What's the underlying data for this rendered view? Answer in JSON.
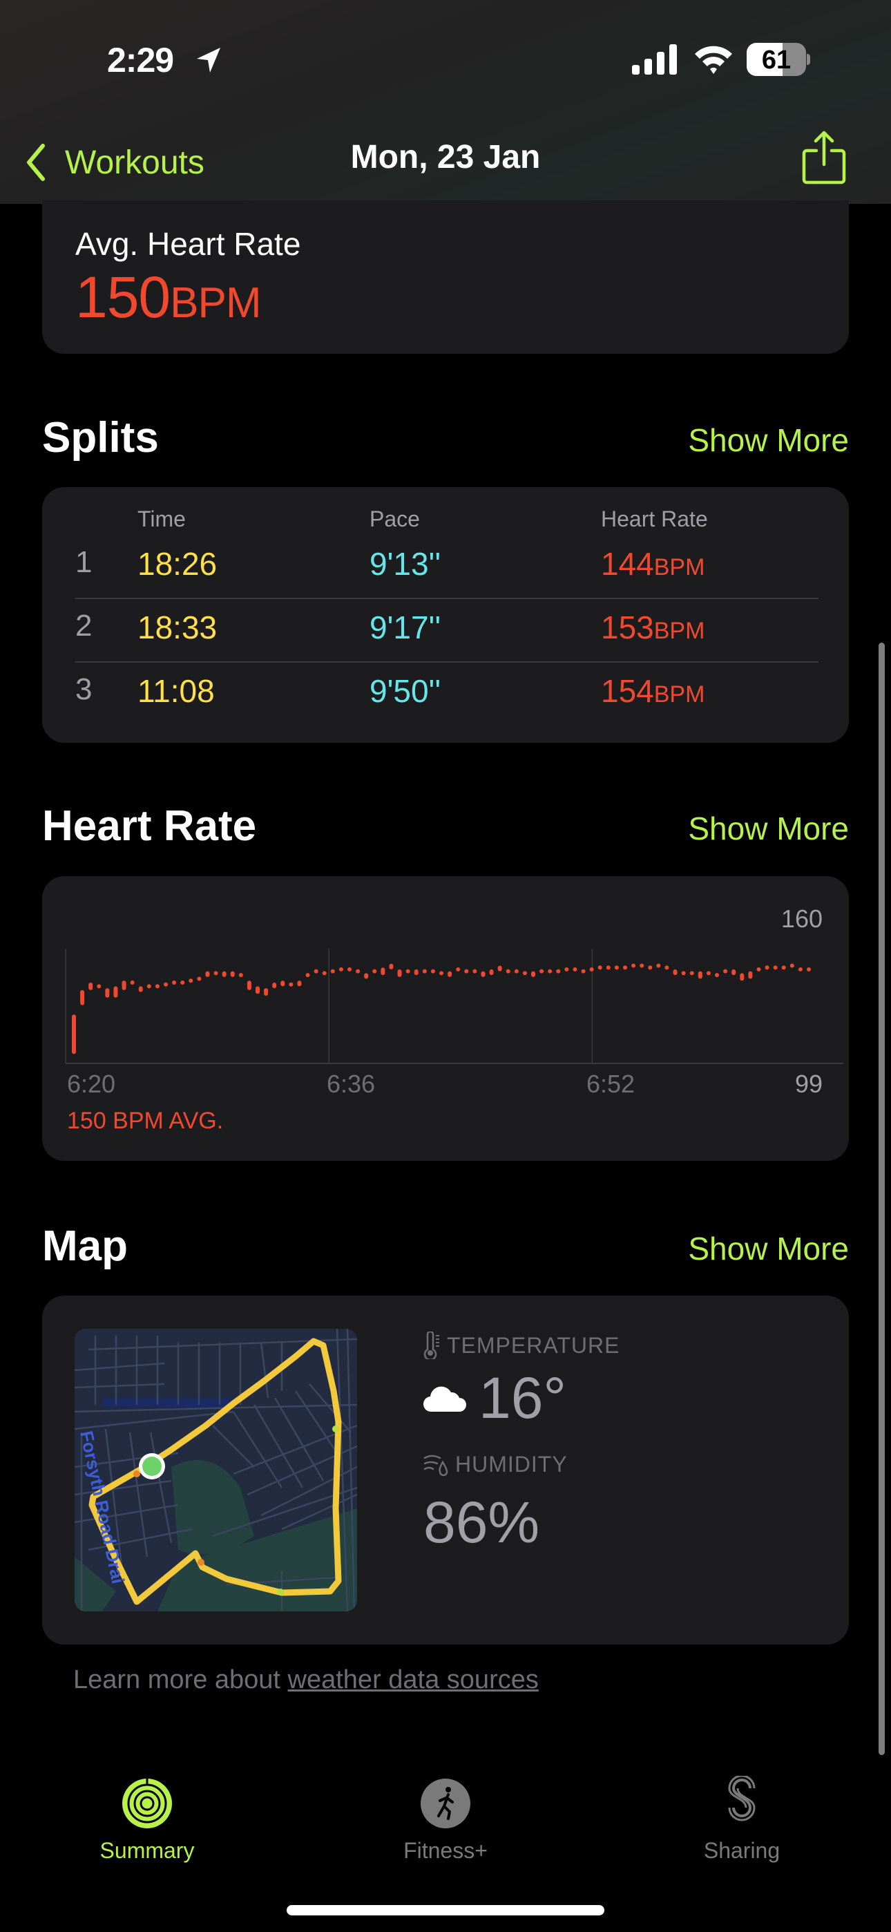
{
  "status_bar": {
    "time": "2:29",
    "battery_percent": 61,
    "battery_label": "61",
    "icons": [
      "location-arrow-icon",
      "cellular-signal-icon",
      "wifi-icon",
      "battery-icon"
    ]
  },
  "nav": {
    "back_label": "Workouts",
    "title": "Mon, 23 Jan",
    "share_icon": "share-icon"
  },
  "colors": {
    "accent": "#b6f24a",
    "heart_rate": "#f0492e",
    "time": "#ffe04a",
    "pace": "#66e6ea",
    "card_bg": "#1c1c1e",
    "route": "#f2c83c",
    "start_marker": "#6dd26a"
  },
  "avg_heart_rate": {
    "label": "Avg. Heart Rate",
    "value": "150",
    "unit": "BPM"
  },
  "splits": {
    "title": "Splits",
    "show_more": "Show More",
    "headers": {
      "time": "Time",
      "pace": "Pace",
      "heart_rate": "Heart Rate"
    },
    "rows": [
      {
        "index": "1",
        "time": "18:26",
        "pace": "9'13''",
        "hr": "144",
        "unit": "BPM"
      },
      {
        "index": "2",
        "time": "18:33",
        "pace": "9'17''",
        "hr": "153",
        "unit": "BPM"
      },
      {
        "index": "3",
        "time": "11:08",
        "pace": "9'50''",
        "hr": "154",
        "unit": "BPM"
      }
    ]
  },
  "heart_rate": {
    "title": "Heart Rate",
    "show_more": "Show More",
    "avg_label": "150 BPM AVG."
  },
  "chart_data": {
    "type": "bar",
    "title": "Heart Rate",
    "xlabel": "",
    "ylabel": "BPM",
    "ylim": [
      99,
      160
    ],
    "y_max_label": "160",
    "y_min_label": "99",
    "x_tick_labels": [
      "6:20",
      "6:36",
      "6:52"
    ],
    "x_ticks_minutes": [
      0,
      16,
      32
    ],
    "x_range_minutes": [
      0,
      46
    ],
    "grid": true,
    "annotation": "150 BPM AVG.",
    "series": [
      {
        "name": "Heart Rate range (BPM)",
        "ranges": [
          [
            104,
            125
          ],
          [
            130,
            138
          ],
          [
            138,
            142
          ],
          [
            139,
            140
          ],
          [
            134,
            139
          ],
          [
            134,
            140
          ],
          [
            138,
            143
          ],
          [
            140,
            142
          ],
          [
            137,
            140
          ],
          [
            138,
            140
          ],
          [
            138,
            140
          ],
          [
            139,
            141
          ],
          [
            141,
            142
          ],
          [
            141,
            142
          ],
          [
            142,
            143
          ],
          [
            142,
            144
          ],
          [
            145,
            148
          ],
          [
            146,
            147
          ],
          [
            145,
            148
          ],
          [
            145,
            148
          ],
          [
            144,
            146
          ],
          [
            138,
            143
          ],
          [
            136,
            140
          ],
          [
            135,
            139
          ],
          [
            139,
            142
          ],
          [
            140,
            143
          ],
          [
            141,
            141
          ],
          [
            140,
            143
          ],
          [
            144,
            146
          ],
          [
            146,
            148
          ],
          [
            147,
            147
          ],
          [
            147,
            148
          ],
          [
            148,
            149
          ],
          [
            147,
            149
          ],
          [
            147,
            148
          ],
          [
            144,
            147
          ],
          [
            146,
            148
          ],
          [
            146,
            150
          ],
          [
            149,
            152
          ],
          [
            145,
            149
          ],
          [
            147,
            148
          ],
          [
            146,
            149
          ],
          [
            146,
            148
          ],
          [
            147,
            148
          ],
          [
            147,
            147
          ],
          [
            145,
            148
          ],
          [
            147,
            149
          ],
          [
            147,
            148
          ],
          [
            147,
            148
          ],
          [
            145,
            148
          ],
          [
            146,
            149
          ],
          [
            148,
            151
          ],
          [
            146,
            148
          ],
          [
            146,
            148
          ],
          [
            145,
            147
          ],
          [
            145,
            148
          ],
          [
            147,
            148
          ],
          [
            147,
            148
          ],
          [
            147,
            148
          ],
          [
            148,
            149
          ],
          [
            147,
            149
          ],
          [
            146,
            148
          ],
          [
            147,
            149
          ],
          [
            148,
            150
          ],
          [
            148,
            150
          ],
          [
            149,
            150
          ],
          [
            149,
            150
          ],
          [
            149,
            151
          ],
          [
            150,
            151
          ],
          [
            149,
            150
          ],
          [
            149,
            151
          ],
          [
            148,
            150
          ],
          [
            146,
            149
          ],
          [
            145,
            147
          ],
          [
            146,
            147
          ],
          [
            144,
            148
          ],
          [
            145,
            147
          ],
          [
            144,
            146
          ],
          [
            146,
            148
          ],
          [
            146,
            149
          ],
          [
            143,
            147
          ],
          [
            144,
            148
          ],
          [
            148,
            149
          ],
          [
            148,
            150
          ],
          [
            148,
            150
          ],
          [
            149,
            150
          ],
          [
            149,
            151
          ],
          [
            147,
            149
          ],
          [
            147,
            149
          ]
        ]
      }
    ]
  },
  "map": {
    "title": "Map",
    "show_more": "Show More",
    "street_label": "Forsyth Road Drai",
    "temperature_label": "TEMPERATURE",
    "temperature_value": "16°",
    "weather_condition_icon": "cloud-icon",
    "humidity_label": "HUMIDITY",
    "humidity_value": "86%"
  },
  "footnote": {
    "prefix": "Learn more about ",
    "link": "weather data sources"
  },
  "tabs": [
    {
      "label": "Summary",
      "icon": "activity-rings-icon",
      "active": true
    },
    {
      "label": "Fitness+",
      "icon": "running-figure-icon",
      "active": false
    },
    {
      "label": "Sharing",
      "icon": "sharing-icon",
      "active": false
    }
  ]
}
